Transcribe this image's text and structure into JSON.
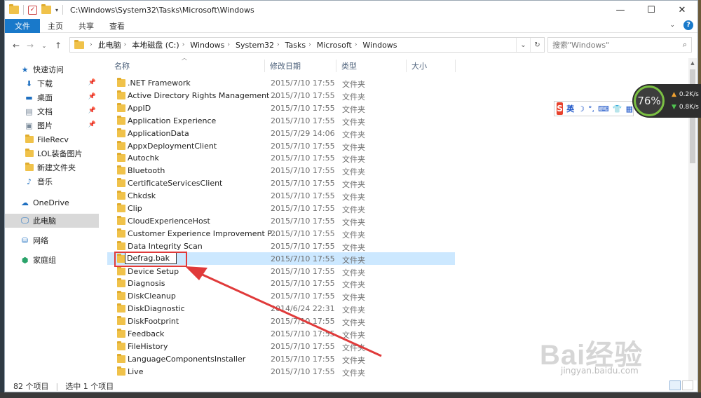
{
  "window": {
    "path": "C:\\Windows\\System32\\Tasks\\Microsoft\\Windows",
    "ctrl_min": "—",
    "ctrl_max": "☐",
    "ctrl_close": "✕"
  },
  "ribbon": {
    "tabs": [
      "文件",
      "主页",
      "共享",
      "查看"
    ]
  },
  "address": {
    "segments": [
      "此电脑",
      "本地磁盘 (C:)",
      "Windows",
      "System32",
      "Tasks",
      "Microsoft",
      "Windows"
    ],
    "search_placeholder": "搜索\"Windows\""
  },
  "sidebar": {
    "items": [
      {
        "label": "快速访问",
        "icon": "star-icon"
      },
      {
        "label": "下载",
        "icon": "download-icon",
        "pinned": true
      },
      {
        "label": "桌面",
        "icon": "desktop-icon",
        "pinned": true
      },
      {
        "label": "文档",
        "icon": "document-icon",
        "pinned": true
      },
      {
        "label": "图片",
        "icon": "picture-icon",
        "pinned": true
      },
      {
        "label": "FileRecv",
        "icon": "folder-icon"
      },
      {
        "label": "LOL装备图片",
        "icon": "folder-icon"
      },
      {
        "label": "新建文件夹",
        "icon": "folder-icon"
      },
      {
        "label": "音乐",
        "icon": "music-icon"
      },
      {
        "label": "OneDrive",
        "icon": "cloud-icon"
      },
      {
        "label": "此电脑",
        "icon": "computer-icon",
        "selected": true
      },
      {
        "label": "网络",
        "icon": "network-icon"
      },
      {
        "label": "家庭组",
        "icon": "homegroup-icon"
      }
    ]
  },
  "columns": {
    "name": "名称",
    "date": "修改日期",
    "type": "类型",
    "size": "大小"
  },
  "files": [
    {
      "name": ".NET Framework",
      "date": "2015/7/10 17:55",
      "type": "文件夹"
    },
    {
      "name": "Active Directory Rights Management ...",
      "date": "2015/7/10 17:55",
      "type": "文件夹"
    },
    {
      "name": "AppID",
      "date": "2015/7/10 17:55",
      "type": "文件夹"
    },
    {
      "name": "Application Experience",
      "date": "2015/7/10 17:55",
      "type": "文件夹"
    },
    {
      "name": "ApplicationData",
      "date": "2015/7/29 14:06",
      "type": "文件夹"
    },
    {
      "name": "AppxDeploymentClient",
      "date": "2015/7/10 17:55",
      "type": "文件夹"
    },
    {
      "name": "Autochk",
      "date": "2015/7/10 17:55",
      "type": "文件夹"
    },
    {
      "name": "Bluetooth",
      "date": "2015/7/10 17:55",
      "type": "文件夹"
    },
    {
      "name": "CertificateServicesClient",
      "date": "2015/7/10 17:55",
      "type": "文件夹"
    },
    {
      "name": "Chkdsk",
      "date": "2015/7/10 17:55",
      "type": "文件夹"
    },
    {
      "name": "Clip",
      "date": "2015/7/10 17:55",
      "type": "文件夹"
    },
    {
      "name": "CloudExperienceHost",
      "date": "2015/7/10 17:55",
      "type": "文件夹"
    },
    {
      "name": "Customer Experience Improvement P...",
      "date": "2015/7/10 17:55",
      "type": "文件夹"
    },
    {
      "name": "Data Integrity Scan",
      "date": "2015/7/10 17:55",
      "type": "文件夹"
    },
    {
      "name": "Defrag.bak",
      "date": "2015/7/10 17:55",
      "type": "文件夹",
      "renaming": true
    },
    {
      "name": "Device Setup",
      "date": "2015/7/10 17:55",
      "type": "文件夹"
    },
    {
      "name": "Diagnosis",
      "date": "2015/7/10 17:55",
      "type": "文件夹"
    },
    {
      "name": "DiskCleanup",
      "date": "2015/7/10 17:55",
      "type": "文件夹"
    },
    {
      "name": "DiskDiagnostic",
      "date": "2014/6/24 22:31",
      "type": "文件夹"
    },
    {
      "name": "DiskFootprint",
      "date": "2015/7/10 17:55",
      "type": "文件夹"
    },
    {
      "name": "Feedback",
      "date": "2015/7/10 17:55",
      "type": "文件夹"
    },
    {
      "name": "FileHistory",
      "date": "2015/7/10 17:55",
      "type": "文件夹"
    },
    {
      "name": "LanguageComponentsInstaller",
      "date": "2015/7/10 17:55",
      "type": "文件夹"
    },
    {
      "name": "Live",
      "date": "2015/7/10 17:55",
      "type": "文件夹"
    }
  ],
  "status": {
    "count": "82 个项目",
    "selected": "选中 1 个项目"
  },
  "ime": {
    "logo": "S",
    "mode": "英",
    "symbols": [
      "☽",
      "°,",
      "⌨",
      "👕",
      "▦"
    ]
  },
  "speed": {
    "percent": "76%",
    "up": "0.2K/s",
    "down": "0.8K/s"
  },
  "watermark": {
    "brand": "Bai经验",
    "url": "jingyan.baidu.com"
  },
  "colors": {
    "accent": "#1979ca",
    "selection": "#cce8ff",
    "annotation": "#e03a3a",
    "folder": "#f0c24a"
  }
}
